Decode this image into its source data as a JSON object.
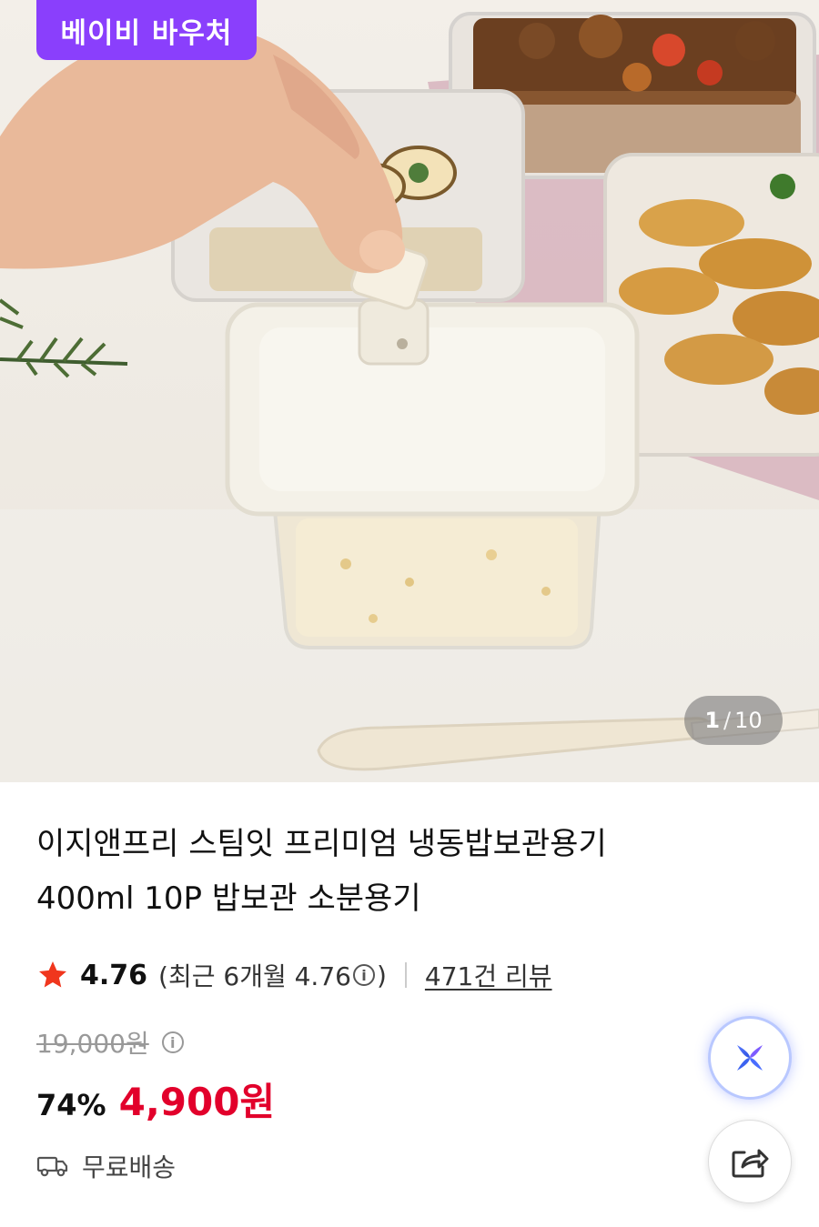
{
  "hero": {
    "badge_label": "베이비 바우처",
    "counter_current": "1",
    "counter_separator": "/",
    "counter_total": "10"
  },
  "product": {
    "title_line1": "이지앤프리 스팀잇 프리미엄 냉동밥보관용기",
    "title_line2": "400ml 10P 밥보관 소분용기",
    "rating": "4.76",
    "recent_rating_prefix": "(최근 6개월 4.76",
    "recent_rating_suffix": ")",
    "review_link": "471건 리뷰",
    "original_price": "19,000원",
    "discount": "74%",
    "price": "4,900원",
    "shipping": "무료배송"
  },
  "icons": {
    "star": "star-icon",
    "info": "info-icon",
    "truck": "truck-icon",
    "ai": "ai-assistant-icon",
    "share": "share-icon"
  },
  "colors": {
    "badge": "#8a3ffc",
    "price": "#e2002b",
    "star": "#f0361d"
  }
}
